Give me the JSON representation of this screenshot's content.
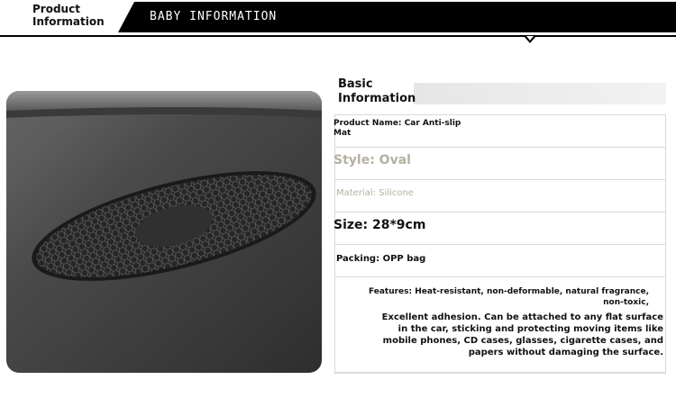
{
  "header": {
    "tab_label": "Product\nInformation",
    "title": "BABY INFORMATION"
  },
  "photo": {
    "alt": "Oval black silicone anti-slip mat on car dashboard",
    "icon": "product-photo"
  },
  "info": {
    "heading": "Basic\nInformation",
    "product_name": "Product Name: Car Anti-slip\nMat",
    "style": "Style: Oval",
    "material": "Material: Silicone",
    "size": "Size: 28*9cm",
    "packing": "Packing: OPP bag",
    "features": "Features: Heat-resistant, non-deformable, natural fragrance, non-toxic,",
    "adhesion": "Excellent adhesion. Can be attached to any flat surface in the car, sticking and protecting moving items like mobile phones, CD cases, glasses, cigarette cases, and papers without damaging the surface."
  },
  "colors": {
    "header_bg": "#000000",
    "muted_text": "#b5b0a1",
    "border": "#d9d9d9"
  }
}
